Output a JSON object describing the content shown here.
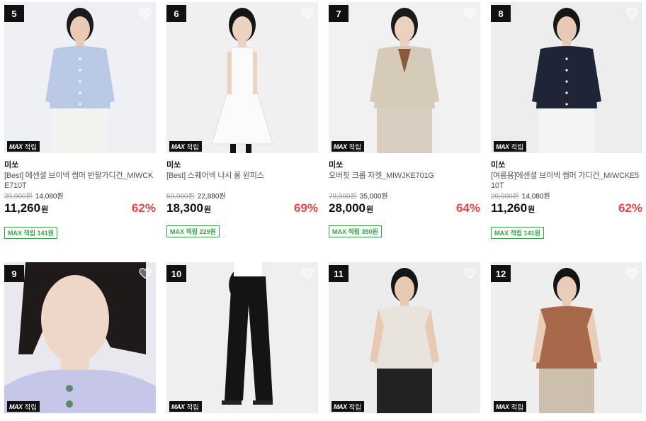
{
  "products": [
    {
      "rank": "5",
      "badge": {
        "logo": "MAX",
        "label": "적립"
      },
      "brand": "미쏘",
      "name": "[Best] 에센셜 브이넥 썸머 반팔가디건_MIWCKE710T",
      "original_price": "29,900원",
      "coupon_price": "14,080원",
      "final_price": "11,260",
      "currency": "원",
      "discount": "62%",
      "points": "MAX 적립 141원",
      "colors": {
        "bg": "#eef0f4",
        "garment": "#b9c9e6",
        "bottom": "#f2f2ef",
        "skin": "#e9cbb5",
        "hair": "#1b1b1b"
      }
    },
    {
      "rank": "6",
      "badge": {
        "logo": "MAX",
        "label": "적립"
      },
      "brand": "미쏘",
      "name": "[Best] 스퀘어넥 나시 롱 원피스",
      "original_price": "59,900원",
      "coupon_price": "22,880원",
      "final_price": "18,300",
      "currency": "원",
      "discount": "69%",
      "points": "MAX 적립 229원",
      "colors": {
        "bg": "#f0f0f0",
        "garment": "#fbfbfb",
        "bottom": "#fbfbfb",
        "skin": "#ecd3c1",
        "hair": "#151515"
      }
    },
    {
      "rank": "7",
      "badge": {
        "logo": "MAX",
        "label": "적립"
      },
      "brand": "미쏘",
      "name": "오버핏 크롭 자켓_MIWJKE701G",
      "original_price": "79,900원",
      "coupon_price": "35,000원",
      "final_price": "28,000",
      "currency": "원",
      "discount": "64%",
      "points": "MAX 적립 350원",
      "colors": {
        "bg": "#f1f1f1",
        "garment": "#d6cab9",
        "bottom": "#d8cdbe",
        "skin": "#ecd1bf",
        "hair": "#1a1a1a"
      }
    },
    {
      "rank": "8",
      "badge": {
        "logo": "MAX",
        "label": "적립"
      },
      "brand": "미쏘",
      "name": "[여름용]에센셜 브이넥 썸머 가디건_MIWCKE510T",
      "original_price": "29,900원",
      "coupon_price": "14,080원",
      "final_price": "11,260",
      "currency": "원",
      "discount": "62%",
      "points": "MAX 적립 141원",
      "colors": {
        "bg": "#ededed",
        "garment": "#1f2436",
        "bottom": "#f4f4f2",
        "skin": "#e6cab6",
        "hair": "#161616"
      }
    },
    {
      "rank": "9",
      "badge": {
        "logo": "MAX",
        "label": "적립"
      },
      "colors": {
        "bg": "#e9e8ee",
        "garment": "#c6c6e8",
        "bottom": "#c6c6e8",
        "skin": "#eed6c8",
        "hair": "#1e1a1a"
      }
    },
    {
      "rank": "10",
      "badge": {
        "logo": "MAX",
        "label": "적립"
      },
      "colors": {
        "bg": "#efefef",
        "garment": "#ffffff",
        "bottom": "#141414",
        "skin": "#e9cdb9",
        "hair": "#1a1a1a"
      }
    },
    {
      "rank": "11",
      "badge": {
        "logo": "MAX",
        "label": "적립"
      },
      "colors": {
        "bg": "#ececec",
        "garment": "#e9e4db",
        "bottom": "#222222",
        "skin": "#e7c9b4",
        "hair": "#151515"
      }
    },
    {
      "rank": "12",
      "badge": {
        "logo": "MAX",
        "label": "적립"
      },
      "colors": {
        "bg": "#eeeeee",
        "garment": "#a8694a",
        "bottom": "#cdbfad",
        "skin": "#e9cdb8",
        "hair": "#141414"
      }
    }
  ]
}
